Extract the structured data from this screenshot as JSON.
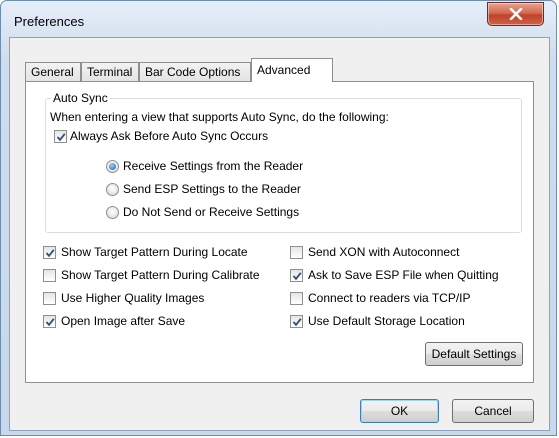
{
  "window": {
    "title": "Preferences"
  },
  "tabs": [
    "General",
    "Terminal",
    "Bar Code Options",
    "Advanced"
  ],
  "active_tab": "Advanced",
  "auto_sync": {
    "group_label": "Auto Sync",
    "description": "When entering a view that supports Auto Sync, do the following:",
    "always_ask": {
      "label": "Always Ask Before Auto Sync Occurs",
      "checked": true
    },
    "options": [
      {
        "label": "Receive Settings from the Reader",
        "selected": true
      },
      {
        "label": "Send ESP Settings to the Reader",
        "selected": false
      },
      {
        "label": "Do Not Send or Receive Settings",
        "selected": false
      }
    ]
  },
  "options_left": [
    {
      "label": "Show Target Pattern During Locate",
      "checked": true
    },
    {
      "label": "Show Target Pattern During Calibrate",
      "checked": false
    },
    {
      "label": "Use Higher Quality Images",
      "checked": false
    },
    {
      "label": "Open Image after Save",
      "checked": true
    }
  ],
  "options_right": [
    {
      "label": "Send XON with Autoconnect",
      "checked": false
    },
    {
      "label": "Ask to Save ESP File when Quitting",
      "checked": true
    },
    {
      "label": "Connect to readers via TCP/IP",
      "checked": false
    },
    {
      "label": "Use Default Storage Location",
      "checked": true
    }
  ],
  "buttons": {
    "default_settings": "Default Settings",
    "ok": "OK",
    "cancel": "Cancel"
  },
  "icons": {
    "close": "close-icon",
    "check": "checkmark-icon",
    "radio": "radio-dot-icon"
  }
}
